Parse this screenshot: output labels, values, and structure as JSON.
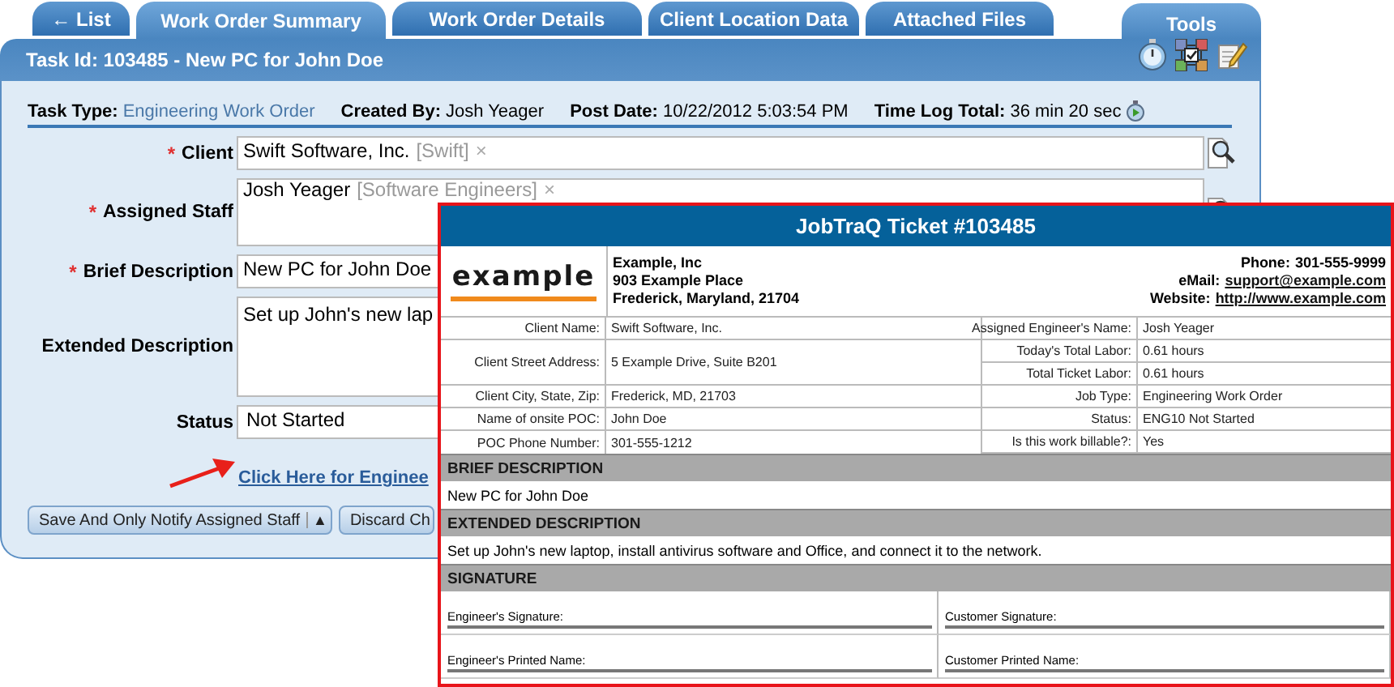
{
  "tabs": [
    {
      "label": "← List",
      "selected": false
    },
    {
      "label": "Work Order Summary",
      "selected": true
    },
    {
      "label": "Work Order Details",
      "selected": false
    },
    {
      "label": "Client Location Data",
      "selected": false
    },
    {
      "label": "Attached Files",
      "selected": false
    }
  ],
  "tools": {
    "label": "Tools"
  },
  "header": {
    "title": "Task Id: 103485 - New PC for John Doe"
  },
  "info": [
    {
      "label": "Task Type:",
      "value": "Engineering Work Order",
      "kind": "link"
    },
    {
      "label": "Created By:",
      "value": "Josh Yeager",
      "kind": "text"
    },
    {
      "label": "Post Date:",
      "value": "10/22/2012 5:03:54 PM",
      "kind": "text"
    },
    {
      "label": "Time Log Total:",
      "value": "36 min 20 sec",
      "kind": "timer"
    }
  ],
  "fields": [
    {
      "label": "Client",
      "mark": "*",
      "kind": "tag",
      "value": "Swift Software, Inc.",
      "tag": "[Swift]",
      "remove": "×",
      "lookup": true
    },
    {
      "label": "Assigned Staff",
      "mark": "*",
      "kind": "tagarea",
      "value": "Josh Yeager",
      "tag": "[Software Engineers]",
      "remove": "×",
      "lookup": true
    },
    {
      "label": "Brief Description",
      "mark": "*",
      "kind": "text",
      "value": "New PC for John Doe",
      "lookup": false
    },
    {
      "label": "Extended Description",
      "kind": "textarea",
      "value": "Set up John's new lap",
      "lookup": false
    },
    {
      "label": "Status",
      "kind": "select",
      "value": "Not Started",
      "lookup": false
    }
  ],
  "link": "Click Here for Enginee",
  "buttons": [
    {
      "label": "Save And Only Notify Assigned Staff",
      "caret": "▲"
    },
    {
      "label": "Discard Ch"
    }
  ],
  "ticket": {
    "title": "JobTraQ Ticket #103485",
    "logo": "example",
    "company": [
      "Example, Inc",
      "903 Example Place",
      "Frederick, Maryland, 21704"
    ],
    "contact": [
      {
        "label": "Phone:",
        "value": "301-555-9999",
        "link": false
      },
      {
        "label": "eMail:",
        "value": "support@example.com",
        "link": true
      },
      {
        "label": "Website:",
        "value": "http://www.example.com",
        "link": true
      }
    ],
    "details_left": [
      {
        "label": "Client Name:",
        "value": "Swift Software, Inc."
      },
      {
        "label": "Client Street Address:",
        "value": "5 Example Drive, Suite B201"
      },
      {
        "label": "Client City, State, Zip:",
        "value": "Frederick, MD, 21703"
      },
      {
        "label": "Name of onsite POC:",
        "value": "John Doe"
      },
      {
        "label": "POC Phone Number:",
        "value": "301-555-1212"
      }
    ],
    "details_right": [
      {
        "label": "Assigned Engineer's Name:",
        "value": "Josh Yeager"
      },
      {
        "label": "Today's Total Labor:",
        "value": "0.61 hours"
      },
      {
        "label": "Total Ticket Labor:",
        "value": "0.61 hours"
      },
      {
        "label": "Job Type:",
        "value": "Engineering Work Order"
      },
      {
        "label": "Status:",
        "value": "ENG10 Not Started"
      },
      {
        "label": "Is this work billable?:",
        "value": "Yes"
      }
    ],
    "sections": [
      {
        "heading": "BRIEF DESCRIPTION",
        "text": "New PC for John Doe"
      },
      {
        "heading": "EXTENDED DESCRIPTION",
        "text": "Set up John's new laptop, install antivirus software and Office, and connect it to the network."
      }
    ],
    "signature": {
      "heading": "SIGNATURE",
      "lines": [
        "Engineer's Signature:",
        "Customer Signature:",
        "Engineer's Printed Name:",
        "Customer Printed Name:"
      ]
    }
  }
}
